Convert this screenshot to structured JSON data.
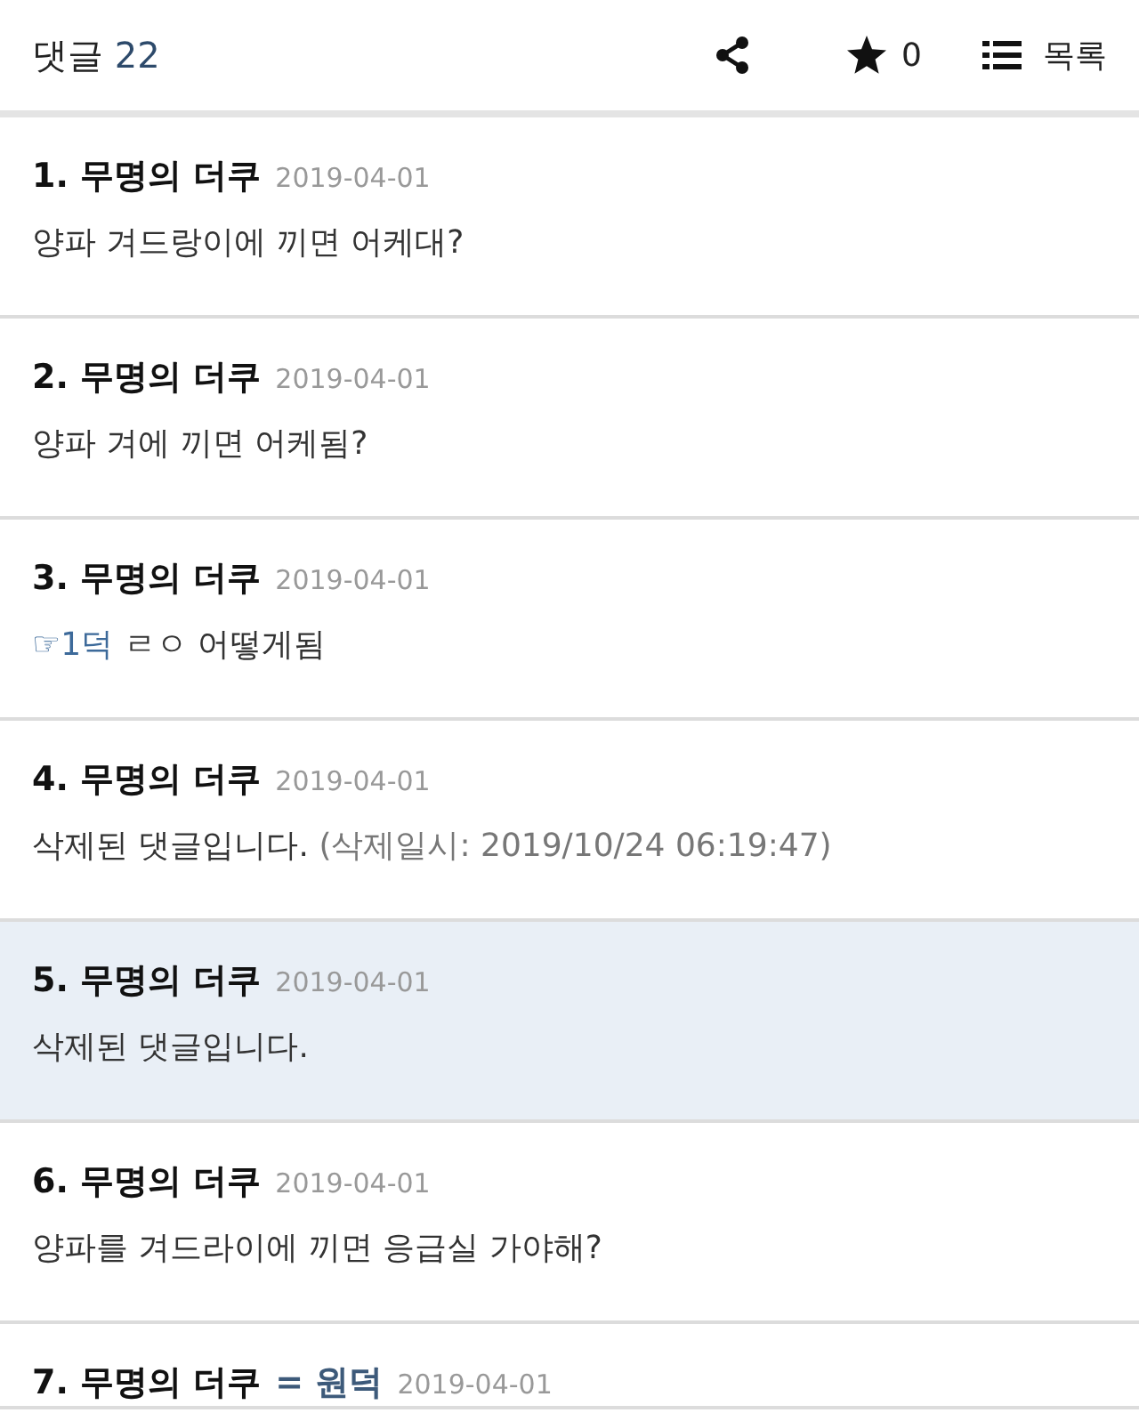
{
  "header": {
    "title": "댓글",
    "count": "22",
    "star_count": "0",
    "list_label": "목록"
  },
  "comments": [
    {
      "label": "1. 무명의 더쿠",
      "date": "2019-04-01",
      "body": "양파 겨드랑이에 끼면 어케대?",
      "highlighted": false
    },
    {
      "label": "2. 무명의 더쿠",
      "date": "2019-04-01",
      "body": "양파 겨에 끼면 어케됨?",
      "highlighted": false
    },
    {
      "label": "3. 무명의 더쿠",
      "date": "2019-04-01",
      "reply_ref": "☞1덕",
      "body": "ㄹㅇ 어떻게됨",
      "highlighted": false
    },
    {
      "label": "4. 무명의 더쿠",
      "date": "2019-04-01",
      "body": "삭제된 댓글입니다.",
      "deleted_note": "(삭제일시: 2019/10/24 06:19:47)",
      "highlighted": false
    },
    {
      "label": "5. 무명의 더쿠",
      "date": "2019-04-01",
      "body": "삭제된 댓글입니다.",
      "highlighted": true
    },
    {
      "label": "6. 무명의 더쿠",
      "date": "2019-04-01",
      "body": "양파를 겨드라이에 끼면 응급실 가야해?",
      "highlighted": false
    },
    {
      "label": "7. 무명의 더쿠",
      "author_tag": "= 원덕",
      "date": "2019-04-01",
      "highlighted": false
    }
  ]
}
